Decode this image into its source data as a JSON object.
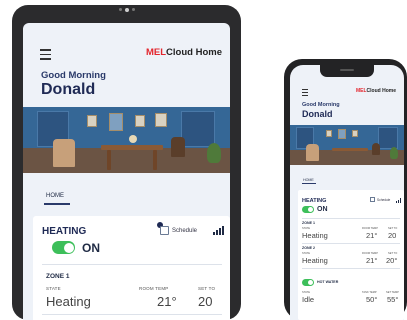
{
  "brand": {
    "prefix": "MEL",
    "suffix": "Cloud Home"
  },
  "greeting": "Good Morning",
  "user_name": "Donald",
  "tabs": [
    {
      "label": "HOME",
      "active": true
    }
  ],
  "heating": {
    "title": "HEATING",
    "power_label": "ON",
    "power_on": true,
    "schedule_label": "Schedule"
  },
  "zones": [
    {
      "name": "ZONE 1",
      "columns": {
        "state": "STATE",
        "room_temp": "ROOM TEMP",
        "set_to": "SET TO"
      },
      "state": "Heating",
      "room_temp": "21°",
      "set_to": "20"
    },
    {
      "name": "ZONE 2",
      "columns": {
        "state": "STATE",
        "room_temp": "ROOM TEMP",
        "set_to": "SET TO"
      },
      "state": "Heating",
      "room_temp": "21°",
      "set_to": "20°"
    }
  ],
  "hot_water": {
    "label": "HOT WATER",
    "power_on": true,
    "columns": {
      "state": "STATE",
      "tank_temp": "TANK TEMP",
      "set_temp": "SET TEMP"
    },
    "state": "Idle",
    "tank_temp": "50°",
    "set_temp": "55°"
  },
  "colors": {
    "brand_red": "#e3262e",
    "navy": "#1f2a55",
    "toggle_on": "#3dbf5a",
    "screen_bg": "#eef2f8"
  }
}
